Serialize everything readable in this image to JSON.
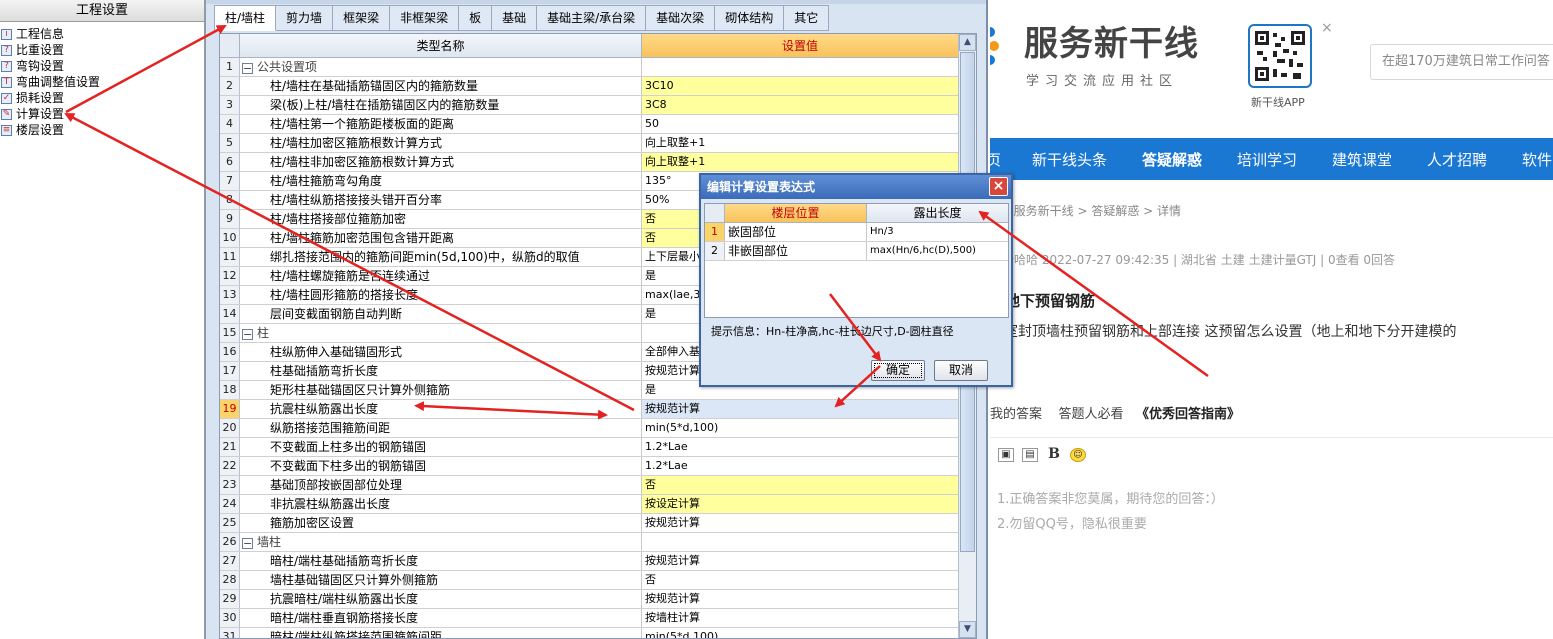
{
  "left_panel": {
    "title": "工程设置",
    "items": [
      {
        "label": "工程信息",
        "icon": "info-icon"
      },
      {
        "label": "比重设置",
        "icon": "question-icon"
      },
      {
        "label": "弯钩设置",
        "icon": "hook-icon"
      },
      {
        "label": "弯曲调整值设置",
        "icon": "bend-icon"
      },
      {
        "label": "损耗设置",
        "icon": "loss-icon"
      },
      {
        "label": "计算设置",
        "icon": "calc-icon"
      },
      {
        "label": "楼层设置",
        "icon": "floor-icon"
      }
    ]
  },
  "tabs": [
    "柱/墙柱",
    "剪力墙",
    "框架梁",
    "非框架梁",
    "板",
    "基础",
    "基础主梁/承台梁",
    "基础次梁",
    "砌体结构",
    "其它"
  ],
  "grid": {
    "col_name": "类型名称",
    "col_value": "设置值",
    "rows": [
      {
        "n": "1",
        "name": "公共设置项",
        "value": "",
        "group": true
      },
      {
        "n": "2",
        "name": "柱/墙柱在基础插筋锚固区内的箍筋数量",
        "value": "3C10",
        "yellow": true
      },
      {
        "n": "3",
        "name": "梁(板)上柱/墙柱在插筋锚固区内的箍筋数量",
        "value": "3C8",
        "yellow": true
      },
      {
        "n": "4",
        "name": "柱/墙柱第一个箍筋距楼板面的距离",
        "value": "50"
      },
      {
        "n": "5",
        "name": "柱/墙柱加密区箍筋根数计算方式",
        "value": "向上取整+1"
      },
      {
        "n": "6",
        "name": "柱/墙柱非加密区箍筋根数计算方式",
        "value": "向上取整+1",
        "yellow": true
      },
      {
        "n": "7",
        "name": "柱/墙柱箍筋弯勾角度",
        "value": "135°"
      },
      {
        "n": "8",
        "name": "柱/墙柱纵筋搭接接头错开百分率",
        "value": "50%"
      },
      {
        "n": "9",
        "name": "柱/墙柱搭接部位箍筋加密",
        "value": "否",
        "yellow": true
      },
      {
        "n": "10",
        "name": "柱/墙柱箍筋加密范围包含错开距离",
        "value": "否",
        "yellow": true
      },
      {
        "n": "11",
        "name": "绑扎搭接范围内的箍筋间距min(5d,100)中，纵筋d的取值",
        "value": "上下层最小"
      },
      {
        "n": "12",
        "name": "柱/墙柱螺旋箍筋是否连续通过",
        "value": "是"
      },
      {
        "n": "13",
        "name": "柱/墙柱圆形箍筋的搭接长度",
        "value": "max(lae,30"
      },
      {
        "n": "14",
        "name": "层间变截面钢筋自动判断",
        "value": "是"
      },
      {
        "n": "15",
        "name": "柱",
        "value": "",
        "group": true
      },
      {
        "n": "16",
        "name": "柱纵筋伸入基础锚固形式",
        "value": "全部伸入基"
      },
      {
        "n": "17",
        "name": "柱基础插筋弯折长度",
        "value": "按规范计算"
      },
      {
        "n": "18",
        "name": "矩形柱基础锚固区只计算外侧箍筋",
        "value": "是"
      },
      {
        "n": "19",
        "name": "抗震柱纵筋露出长度",
        "value": "按规范计算",
        "selected": true
      },
      {
        "n": "20",
        "name": "纵筋搭接范围箍筋间距",
        "value": "min(5*d,100)"
      },
      {
        "n": "21",
        "name": "不变截面上柱多出的钢筋锚固",
        "value": "1.2*Lae"
      },
      {
        "n": "22",
        "name": "不变截面下柱多出的钢筋锚固",
        "value": "1.2*Lae"
      },
      {
        "n": "23",
        "name": "基础顶部按嵌固部位处理",
        "value": "否",
        "yellow": true
      },
      {
        "n": "24",
        "name": "非抗震柱纵筋露出长度",
        "value": "按设定计算",
        "yellow": true
      },
      {
        "n": "25",
        "name": "箍筋加密区设置",
        "value": "按规范计算"
      },
      {
        "n": "26",
        "name": "墙柱",
        "value": "",
        "group": true
      },
      {
        "n": "27",
        "name": "暗柱/端柱基础插筋弯折长度",
        "value": "按规范计算"
      },
      {
        "n": "28",
        "name": "墙柱基础锚固区只计算外侧箍筋",
        "value": "否"
      },
      {
        "n": "29",
        "name": "抗震暗柱/端柱纵筋露出长度",
        "value": "按规范计算"
      },
      {
        "n": "30",
        "name": "暗柱/端柱垂直钢筋搭接长度",
        "value": "按墙柱计算"
      },
      {
        "n": "31",
        "name": "暗柱/端柱纵筋搭接范围箍筋间距",
        "value": "min(5*d,100)"
      }
    ]
  },
  "dialog": {
    "title": "编辑计算设置表达式",
    "col1": "楼层位置",
    "col2": "露出长度",
    "rows": [
      {
        "n": "1",
        "pos": "嵌固部位",
        "len": "Hn/3"
      },
      {
        "n": "2",
        "pos": "非嵌固部位",
        "len": "max(Hn/6,hc(D),500)"
      }
    ],
    "hint": "提示信息：Hn-柱净高,hc-柱长边尺寸,D-圆柱直径",
    "ok": "确定",
    "cancel": "取消",
    "close": "×"
  },
  "web": {
    "logo": "服务新干线",
    "logo_sub": "学习交流应用社区",
    "qr_label": "新干线APP",
    "qr_close": "×",
    "search_placeholder": "在超170万建筑日常工作问答",
    "nav": [
      {
        "label": "页",
        "bold": false
      },
      {
        "label": "新干线头条",
        "bold": false
      },
      {
        "label": "答疑解惑",
        "bold": true
      },
      {
        "label": "培训学习",
        "bold": false
      },
      {
        "label": "建筑课堂",
        "bold": false
      },
      {
        "label": "人才招聘",
        "bold": false
      },
      {
        "label": "软件",
        "bold": false
      }
    ],
    "breadcrumb": "置 : 服务新干线 > 答疑解惑 > 详情",
    "meta": "哈哈哈哈   2022-07-27 09:42:35    |    湖北省  土建 土建计量GTJ    |    0查看  0回答",
    "question_title": "上地下预留钢筋",
    "question_text": "下室封顶墙柱预留钢筋和上部连接   这预留怎么设置（地上和地下分开建模的",
    "answer_bar_a": "我的答案",
    "answer_bar_b": "答题人必看",
    "answer_bar_c": "《优秀回答指南》",
    "bold_btn": "B",
    "hint1": "1.正确答案非您莫属，期待您的回答：）",
    "hint2": "2.勿留QQ号，隐私很重要"
  },
  "colors": {
    "arrow": "#e52222",
    "nav_blue": "#1b78d2",
    "value_header": "#f9c35a",
    "yellow_cell": "#ffff9e"
  }
}
